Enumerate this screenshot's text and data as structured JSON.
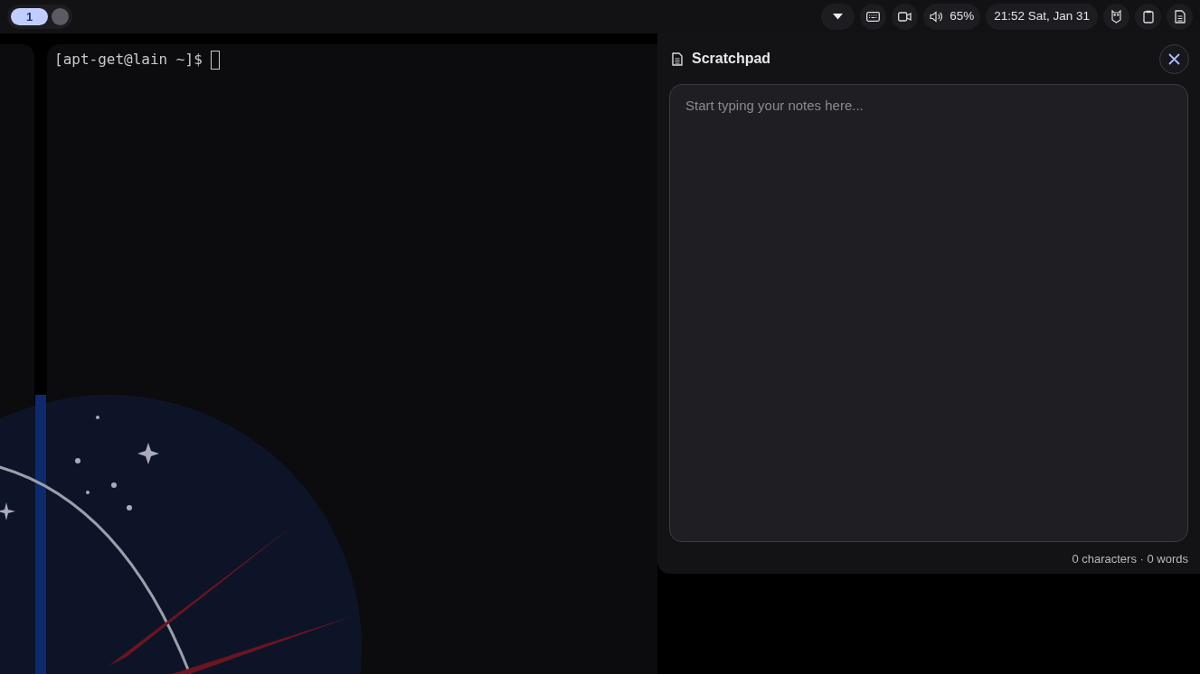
{
  "top_bar": {
    "workspaces": [
      {
        "label": "1",
        "selected": true
      },
      {
        "selected": false
      }
    ],
    "tray": [
      {
        "kind": "dropdown"
      },
      {
        "kind": "keyboard"
      },
      {
        "kind": "camera"
      },
      {
        "kind": "volume",
        "text": "65%"
      },
      {
        "kind": "clock",
        "text": "21:52 Sat, Jan 31"
      },
      {
        "kind": "owl"
      },
      {
        "kind": "clipboard"
      },
      {
        "kind": "notes"
      }
    ]
  },
  "terminal": {
    "prompt": "[apt-get@lain ~]$"
  },
  "scratchpad": {
    "title": "Scratchpad",
    "placeholder": "Start typing your notes here...",
    "footer": "0 characters · 0 words"
  }
}
